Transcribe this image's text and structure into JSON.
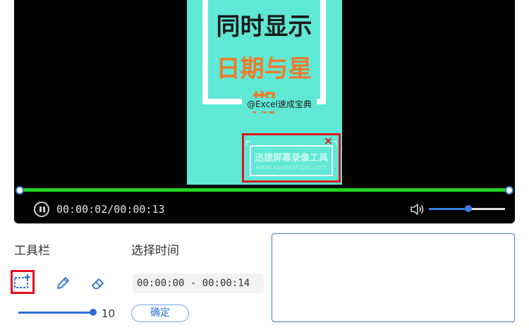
{
  "video": {
    "title_line1": "同时显示",
    "title_line2": "日期与星期",
    "credit": "@Excel速成宝典",
    "watermark_line1": "迅捷屏幕录像工具",
    "watermark_line2": "www.xunjieshipin.com",
    "watermark_close": "×"
  },
  "player": {
    "time_display": "00:00:02/00:00:13",
    "progress": 1.0,
    "volume": 0.52,
    "accent_color": "#21d421"
  },
  "toolbar": {
    "label": "工具栏",
    "tools": [
      "add-selection-icon",
      "pen-icon",
      "eraser-icon"
    ],
    "size_value": "10"
  },
  "time_select": {
    "label": "选择时间",
    "range": "00:00:00 - 00:00:14",
    "confirm_label": "确定"
  }
}
